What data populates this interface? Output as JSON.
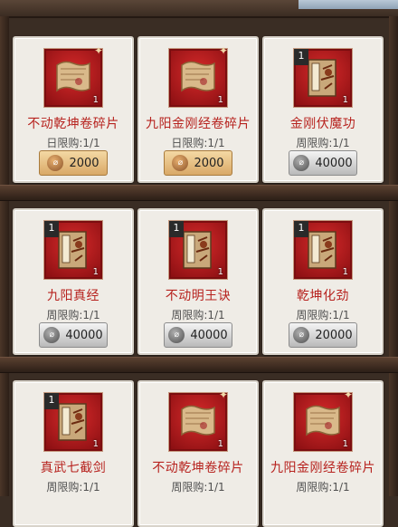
{
  "items": [
    {
      "name": "不动乾坤卷碎片",
      "limit": "日限购:1/1",
      "price": "2000",
      "currency": "gold",
      "qty": "1",
      "icon": "scroll-fragment-icon"
    },
    {
      "name": "九阳金刚经卷碎片",
      "limit": "日限购:1/1",
      "price": "2000",
      "currency": "gold",
      "qty": "1",
      "icon": "scroll-fragment-icon"
    },
    {
      "name": "金刚伏魔功",
      "limit": "周限购:1/1",
      "price": "40000",
      "currency": "silver",
      "qty": "1",
      "level": "1",
      "icon": "martial-manual-icon"
    },
    {
      "name": "九阳真经",
      "limit": "周限购:1/1",
      "price": "40000",
      "currency": "silver",
      "qty": "1",
      "level": "1",
      "icon": "martial-manual-icon"
    },
    {
      "name": "不动明王诀",
      "limit": "周限购:1/1",
      "price": "40000",
      "currency": "silver",
      "qty": "1",
      "level": "1",
      "icon": "martial-manual-icon"
    },
    {
      "name": "乾坤化劲",
      "limit": "周限购:1/1",
      "price": "20000",
      "currency": "silver",
      "qty": "1",
      "level": "1",
      "icon": "martial-manual-icon"
    },
    {
      "name": "真武七截剑",
      "limit": "周限购:1/1",
      "qty": "1",
      "level": "1",
      "icon": "martial-manual-icon"
    },
    {
      "name": "不动乾坤卷碎片",
      "limit": "周限购:1/1",
      "qty": "1",
      "icon": "scroll-fragment-icon"
    },
    {
      "name": "九阳金刚经卷碎片",
      "limit": "周限购:1/1",
      "qty": "1",
      "icon": "scroll-fragment-icon"
    }
  ]
}
